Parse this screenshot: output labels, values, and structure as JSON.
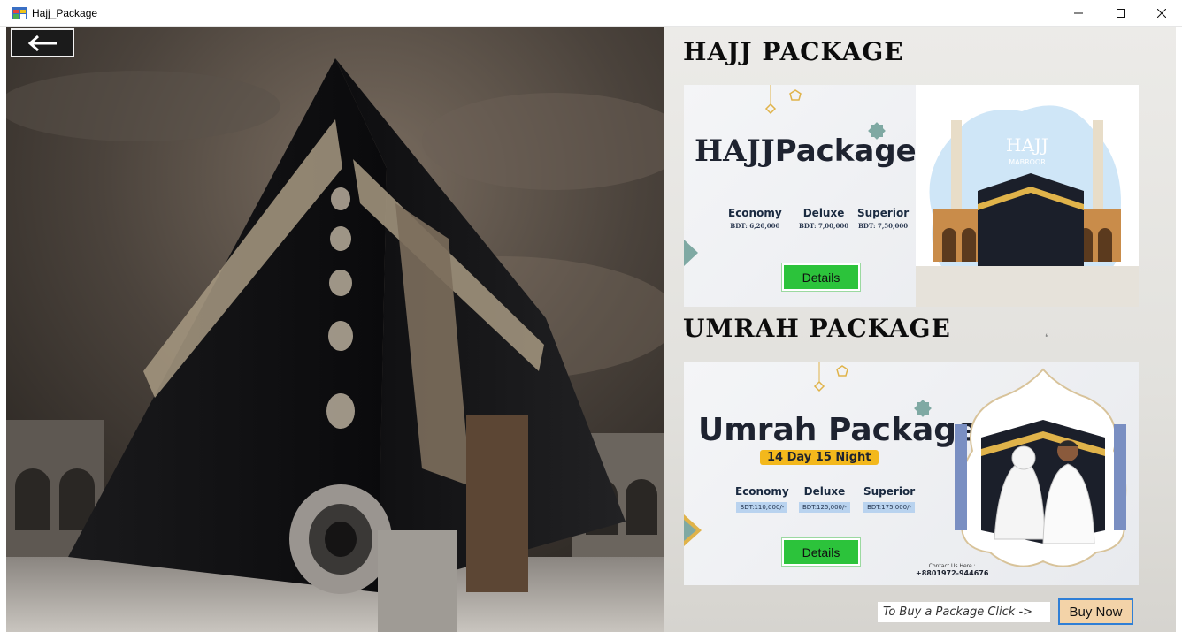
{
  "window": {
    "title": "Hajj_Package",
    "controls": {
      "minimize": "—",
      "maximize": "☐",
      "close": "✕"
    }
  },
  "back_button": {
    "icon": "arrow-left-icon"
  },
  "hajj": {
    "section_title": "HAJJ PACKAGE",
    "banner_word1": "HAJJ",
    "banner_word2": "Package",
    "badge_title": "HAJJ",
    "badge_subtitle": "MABROOR",
    "tiers": [
      {
        "name": "Economy",
        "price": "BDT: 6,20,000"
      },
      {
        "name": "Deluxe",
        "price": "BDT: 7,00,000"
      },
      {
        "name": "Superior",
        "price": "BDT: 7,50,000"
      }
    ],
    "details_label": "Details"
  },
  "umrah": {
    "section_title": "UMRAH PACKAGE",
    "banner_title": "Umrah Package",
    "duration": "14 Day 15 Night",
    "tiers": [
      {
        "name": "Economy",
        "price": "BDT:110,000/-"
      },
      {
        "name": "Deluxe",
        "price": "BDT:125,000/-"
      },
      {
        "name": "Superior",
        "price": "BDT:175,000/-"
      }
    ],
    "details_label": "Details",
    "contact_label": "Contact Us Here :",
    "contact_number": "+8801972-944676"
  },
  "footer": {
    "hint": "To Buy a Package Click  ->",
    "buy_label": "Buy Now"
  },
  "colors": {
    "details_green": "#2cc33b",
    "buy_button_fill": "#f3d3a8",
    "buy_button_border": "#2f7fd6",
    "duration_badge": "#f3b81c",
    "kaaba_cloth": "#141414",
    "gold_band": "#a89a82"
  }
}
